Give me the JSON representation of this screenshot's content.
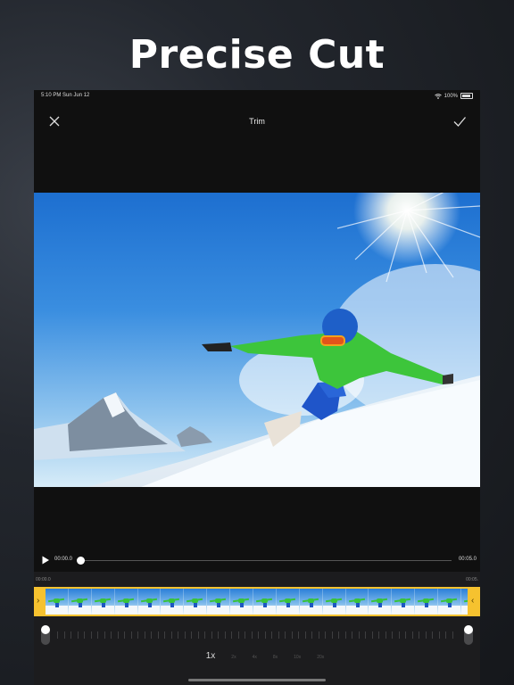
{
  "promo": {
    "headline": "Precise Cut"
  },
  "status_bar": {
    "time_date": "5:10 PM   Sun Jun 12",
    "battery": "100%"
  },
  "toolbar": {
    "title": "Trim",
    "close_icon": "close-icon",
    "confirm_icon": "checkmark-icon"
  },
  "player": {
    "current_time": "00:00.0",
    "end_time": "00:05.0",
    "progress": 0,
    "play_icon": "play-icon",
    "frame_subject": "snowboarder-photo"
  },
  "timeline": {
    "start_label": "00:00.0",
    "end_label": "00:05.",
    "frame_count": 19,
    "accent_color": "#f6c22f"
  },
  "speed_options": [
    {
      "label": "1x",
      "active": true
    },
    {
      "label": "2x",
      "active": false
    },
    {
      "label": "4x",
      "active": false
    },
    {
      "label": "8x",
      "active": false
    },
    {
      "label": "10x",
      "active": false
    },
    {
      "label": "20x",
      "active": false
    }
  ],
  "colors": {
    "background": "#1f2228",
    "device_bg": "#101010",
    "editor_bg": "#1c1c1e",
    "accent": "#f6c22f"
  }
}
